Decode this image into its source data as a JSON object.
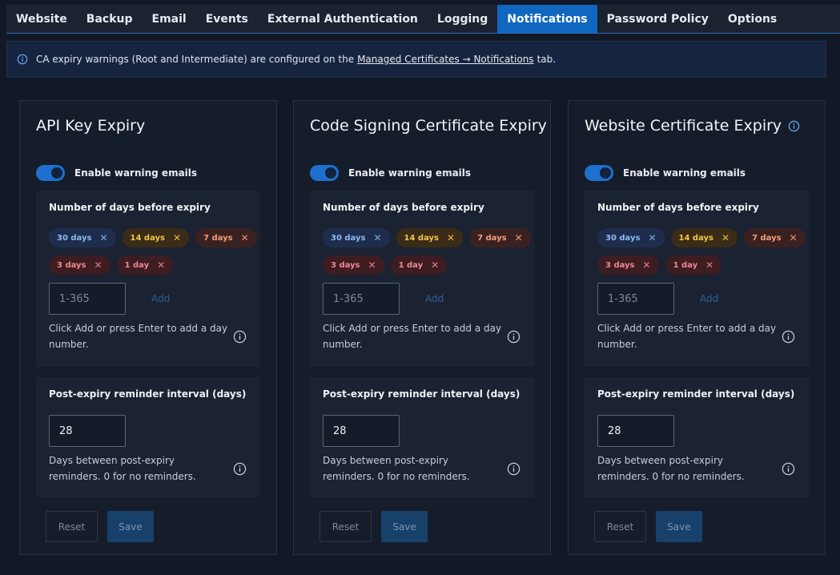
{
  "tabs": [
    {
      "label": "Website",
      "active": false
    },
    {
      "label": "Backup",
      "active": false
    },
    {
      "label": "Email",
      "active": false
    },
    {
      "label": "Events",
      "active": false
    },
    {
      "label": "External Authentication",
      "active": false
    },
    {
      "label": "Logging",
      "active": false
    },
    {
      "label": "Notifications",
      "active": true
    },
    {
      "label": "Password Policy",
      "active": false
    },
    {
      "label": "Options",
      "active": false
    }
  ],
  "banner": {
    "icon": "info-icon",
    "text_before": "CA expiry warnings (Root and Intermediate) are configured on the",
    "link": "Managed Certificates → Notifications",
    "text_after": "tab."
  },
  "cards": [
    {
      "title": "API Key Expiry",
      "has_info_icon": false,
      "toggle_label": "Enable warning emails",
      "toggle_on": true,
      "days_title": "Number of days before expiry",
      "chips": [
        {
          "label": "30 days",
          "color": "blue"
        },
        {
          "label": "14 days",
          "color": "yellow"
        },
        {
          "label": "7 days",
          "color": "orange"
        },
        {
          "label": "3 days",
          "color": "red"
        },
        {
          "label": "1 day",
          "color": "red"
        }
      ],
      "days_placeholder": "1-365",
      "add_label": "Add",
      "days_help": "Click Add or press Enter to add a day number.",
      "post_title": "Post-expiry reminder interval (days)",
      "post_value": "28",
      "post_help": "Days between post-expiry reminders. 0 for no reminders.",
      "reset_label": "Reset",
      "save_label": "Save"
    },
    {
      "title": "Code Signing Certificate Expiry",
      "has_info_icon": false,
      "toggle_label": "Enable warning emails",
      "toggle_on": true,
      "days_title": "Number of days before expiry",
      "chips": [
        {
          "label": "30 days",
          "color": "blue"
        },
        {
          "label": "14 days",
          "color": "yellow"
        },
        {
          "label": "7 days",
          "color": "orange"
        },
        {
          "label": "3 days",
          "color": "red"
        },
        {
          "label": "1 day",
          "color": "red"
        }
      ],
      "days_placeholder": "1-365",
      "add_label": "Add",
      "days_help": "Click Add or press Enter to add a day number.",
      "post_title": "Post-expiry reminder interval (days)",
      "post_value": "28",
      "post_help": "Days between post-expiry reminders. 0 for no reminders.",
      "reset_label": "Reset",
      "save_label": "Save"
    },
    {
      "title": "Website Certificate Expiry",
      "has_info_icon": true,
      "toggle_label": "Enable warning emails",
      "toggle_on": true,
      "days_title": "Number of days before expiry",
      "chips": [
        {
          "label": "30 days",
          "color": "blue"
        },
        {
          "label": "14 days",
          "color": "yellow"
        },
        {
          "label": "7 days",
          "color": "orange"
        },
        {
          "label": "3 days",
          "color": "red"
        },
        {
          "label": "1 day",
          "color": "red"
        }
      ],
      "days_placeholder": "1-365",
      "add_label": "Add",
      "days_help": "Click Add or press Enter to add a day number.",
      "post_title": "Post-expiry reminder interval (days)",
      "post_value": "28",
      "post_help": "Days between post-expiry reminders. 0 for no reminders.",
      "reset_label": "Reset",
      "save_label": "Save"
    }
  ],
  "colors": {
    "accent": "#0f67bf",
    "background": "#111826",
    "card": "#151d2b"
  }
}
